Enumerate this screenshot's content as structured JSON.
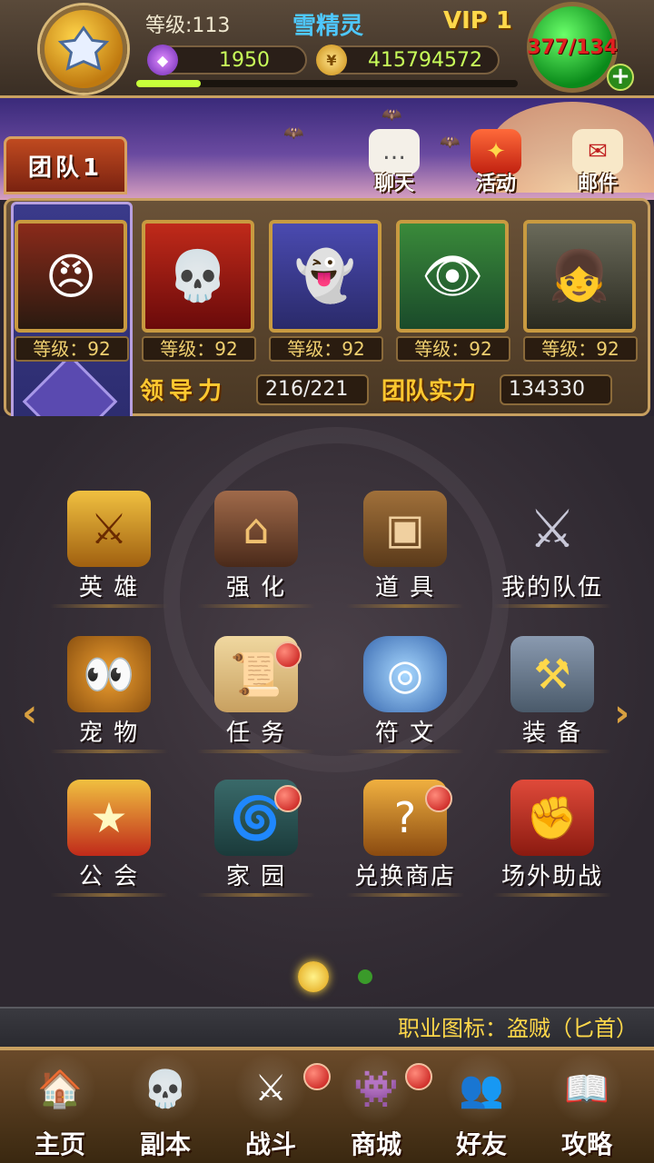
{
  "player": {
    "level_text": "等级:113",
    "name": "雪精灵",
    "vip": "VIP 1",
    "gems": "1950",
    "gold": "415794572",
    "energy": "377/134",
    "exp_progress": 0.17
  },
  "top_buttons": {
    "chat": "聊天",
    "activity": "活动",
    "mail": "邮件"
  },
  "team_tab": "团队1",
  "heroes": [
    {
      "level": "等级：92",
      "icon": "armored-warrior-portrait"
    },
    {
      "level": "等级：92",
      "icon": "mummy-portrait"
    },
    {
      "level": "等级：92",
      "icon": "ghost-elf-portrait"
    },
    {
      "level": "等级：92",
      "icon": "green-sorceress-portrait"
    },
    {
      "level": "等级：92",
      "icon": "girl-portrait"
    }
  ],
  "stats": {
    "leadership_label": "领导力",
    "leadership_value": "216/221",
    "power_label": "团队实力",
    "power_value": "134330"
  },
  "menu": [
    {
      "label": "英 雄",
      "icon": "hero-card-icon"
    },
    {
      "label": "强 化",
      "icon": "forge-icon"
    },
    {
      "label": "道 具",
      "icon": "backpack-icon"
    },
    {
      "label": "我的队伍",
      "icon": "crossed-swords-icon"
    },
    {
      "label": "宠 物",
      "icon": "pet-icon"
    },
    {
      "label": "任 务",
      "icon": "scroll-icon"
    },
    {
      "label": "符 文",
      "icon": "rune-icon"
    },
    {
      "label": "装 备",
      "icon": "anvil-icon"
    },
    {
      "label": "公 会",
      "icon": "guild-shield-icon"
    },
    {
      "label": "家 园",
      "icon": "portal-icon"
    },
    {
      "label": "兑换商店",
      "icon": "mystery-chest-icon"
    },
    {
      "label": "场外助战",
      "icon": "fist-banner-icon"
    }
  ],
  "hint": "职业图标：盗贼（匕首）",
  "nav": [
    {
      "label": "主页",
      "icon": "house-icon"
    },
    {
      "label": "副本",
      "icon": "skull-orb-icon"
    },
    {
      "label": "战斗",
      "icon": "axe-sword-icon"
    },
    {
      "label": "商城",
      "icon": "monster-shop-icon"
    },
    {
      "label": "好友",
      "icon": "friends-icon"
    },
    {
      "label": "攻略",
      "icon": "guide-book-icon"
    }
  ]
}
